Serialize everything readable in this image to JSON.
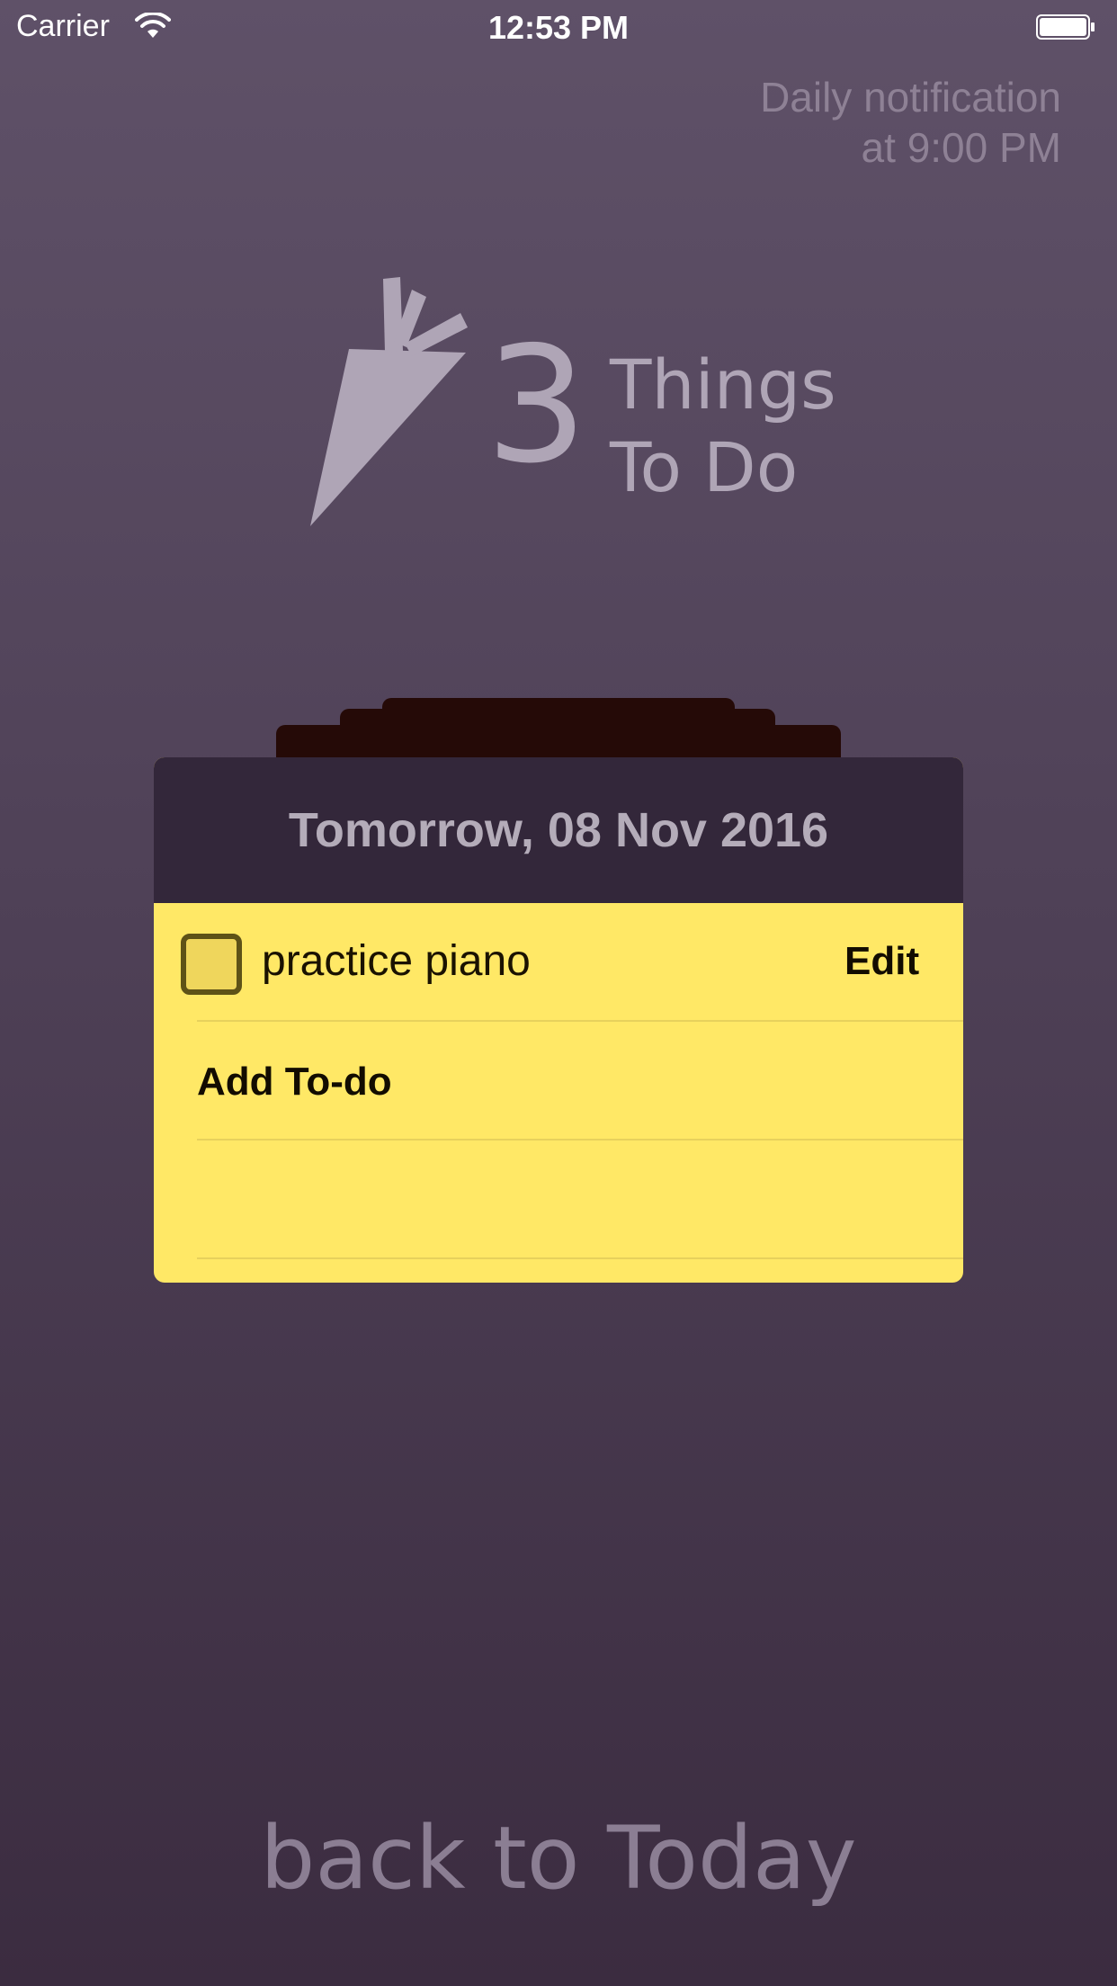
{
  "status_bar": {
    "carrier": "Carrier",
    "time": "12:53 PM"
  },
  "notification": {
    "line1": "Daily notification",
    "line2": "at 9:00 PM"
  },
  "logo": {
    "number": "3",
    "line1": "Things",
    "line2": "To Do",
    "icon": "carrot-icon"
  },
  "card": {
    "date": "Tomorrow, 08 Nov 2016",
    "todos": [
      {
        "text": "practice piano",
        "checked": false,
        "action": "Edit"
      }
    ],
    "add_label": "Add To-do"
  },
  "footer": {
    "back_label": "back to Today"
  },
  "colors": {
    "card_yellow": "#ffe866",
    "header_dark": "#33273a",
    "tab_dark": "#250a07"
  }
}
